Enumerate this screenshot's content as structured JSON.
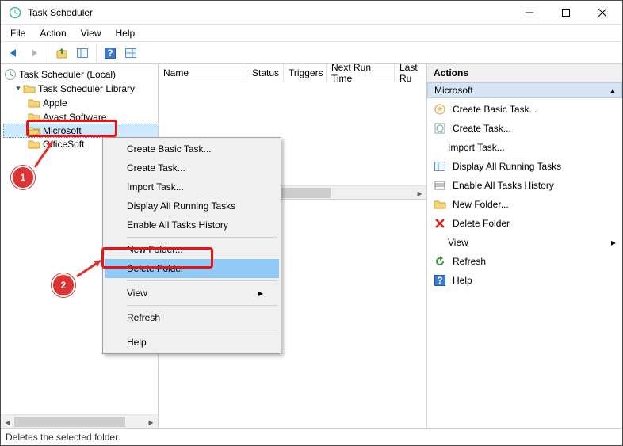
{
  "window": {
    "title": "Task Scheduler"
  },
  "menubar": {
    "file": "File",
    "action": "Action",
    "view": "View",
    "help": "Help"
  },
  "tree": {
    "root": "Task Scheduler (Local)",
    "library": "Task Scheduler Library",
    "items": [
      "Apple",
      "Avast Software",
      "Microsoft",
      "OfficeSoft"
    ],
    "selected_index": 2
  },
  "list": {
    "columns": [
      "Name",
      "Status",
      "Triggers",
      "Next Run Time",
      "Last Ru"
    ]
  },
  "contextmenu": {
    "items": [
      "Create Basic Task...",
      "Create Task...",
      "Import Task...",
      "Display All Running Tasks",
      "Enable All Tasks History",
      "New Folder...",
      "Delete Folder",
      "View",
      "Refresh",
      "Help"
    ],
    "highlighted_index": 6
  },
  "actions": {
    "header": "Actions",
    "section": "Microsoft",
    "items": [
      {
        "icon": "wizard",
        "label": "Create Basic Task..."
      },
      {
        "icon": "task",
        "label": "Create Task..."
      },
      {
        "icon": "none",
        "label": "Import Task..."
      },
      {
        "icon": "running",
        "label": "Display All Running Tasks"
      },
      {
        "icon": "history",
        "label": "Enable All Tasks History"
      },
      {
        "icon": "folder",
        "label": "New Folder..."
      },
      {
        "icon": "delete",
        "label": "Delete Folder"
      },
      {
        "icon": "none",
        "label": "View",
        "submenu": true
      },
      {
        "icon": "refresh",
        "label": "Refresh"
      },
      {
        "icon": "help",
        "label": "Help"
      }
    ]
  },
  "statusbar": {
    "text": "Deletes the selected folder."
  },
  "annotations": {
    "callout1": "1",
    "callout2": "2"
  }
}
